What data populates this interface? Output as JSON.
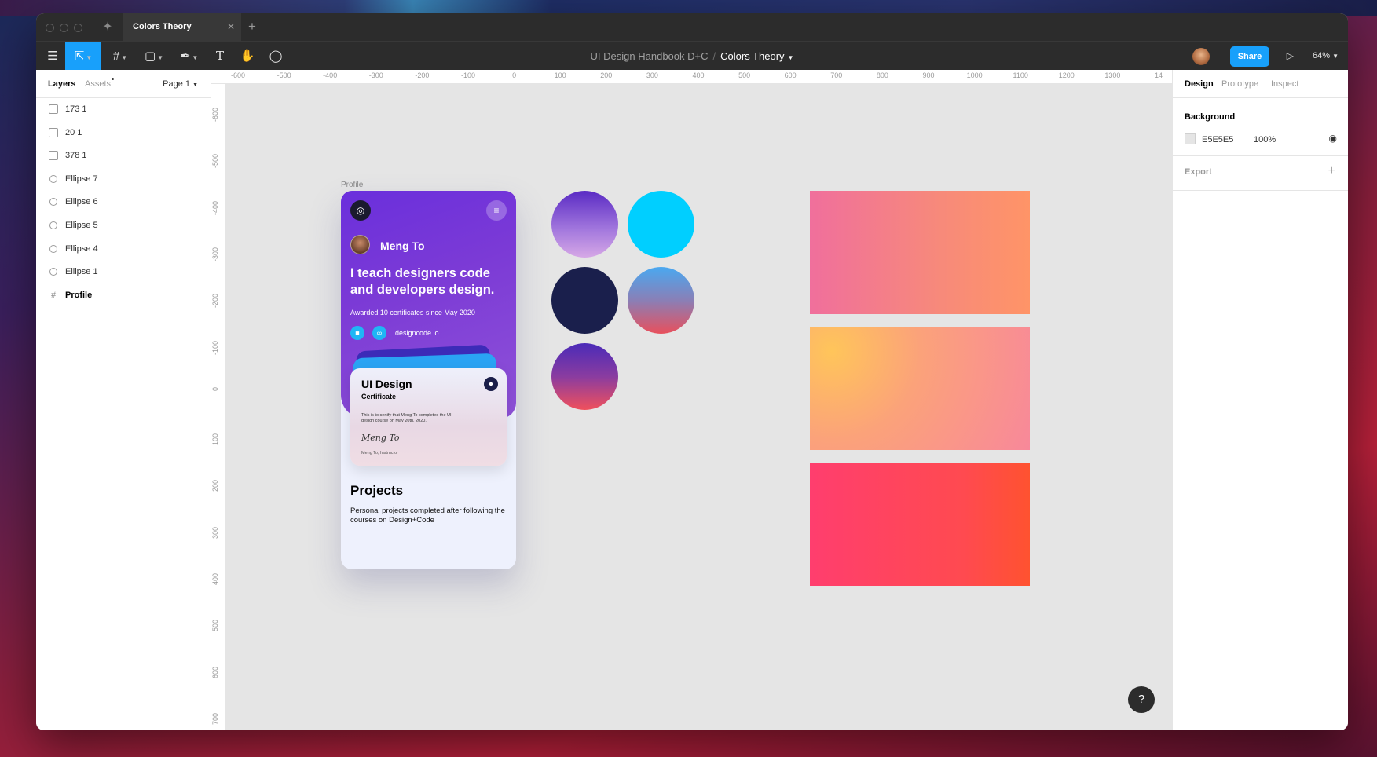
{
  "app": {
    "tab_title": "Colors Theory"
  },
  "toolbar": {
    "project": "UI Design Handbook D+C",
    "separator": "/",
    "file": "Colors Theory",
    "share_label": "Share",
    "zoom": "64%"
  },
  "left_panel": {
    "tab_layers": "Layers",
    "tab_assets": "Assets",
    "page_select": "Page 1",
    "layers": [
      {
        "label": "173 1",
        "type": "image"
      },
      {
        "label": "20 1",
        "type": "image"
      },
      {
        "label": "378 1",
        "type": "image"
      },
      {
        "label": "Ellipse 7",
        "type": "ellipse"
      },
      {
        "label": "Ellipse 6",
        "type": "ellipse"
      },
      {
        "label": "Ellipse 5",
        "type": "ellipse"
      },
      {
        "label": "Ellipse 4",
        "type": "ellipse"
      },
      {
        "label": "Ellipse 1",
        "type": "ellipse"
      },
      {
        "label": "Profile",
        "type": "frame"
      }
    ]
  },
  "ruler": {
    "top": [
      "-600",
      "-500",
      "-400",
      "-300",
      "-200",
      "-100",
      "0",
      "100",
      "200",
      "300",
      "400",
      "500",
      "600",
      "700",
      "800",
      "900",
      "1000",
      "1100",
      "1200",
      "1300",
      "14"
    ],
    "left": [
      "-600",
      "-500",
      "-400",
      "-300",
      "-200",
      "-100",
      "0",
      "100",
      "200",
      "300",
      "400",
      "500",
      "600",
      "700"
    ]
  },
  "canvas": {
    "frame_label": "Profile",
    "profile": {
      "name": "Meng To",
      "headline": "I teach designers code and developers design.",
      "subtitle": "Awarded 10 certificates since May 2020",
      "link": "designcode.io",
      "cert_title": "UI Design",
      "cert_subtitle": "Certificate",
      "cert_body": "This is to certify that Meng To completed the UI design course on May 20th, 2020.",
      "cert_signature": "Meng To",
      "cert_instructor": "Meng To, Instructor",
      "projects_title": "Projects",
      "projects_sub": "Personal projects completed after following the courses on Design+Code"
    },
    "help_label": "?"
  },
  "right_panel": {
    "tab_design": "Design",
    "tab_prototype": "Prototype",
    "tab_inspect": "Inspect",
    "background_title": "Background",
    "background_hex": "E5E5E5",
    "background_opacity": "100%",
    "export_title": "Export"
  },
  "colors": {
    "accent": "#18a0fb",
    "canvas": "#e5e5e5",
    "toolbar": "#2c2c2c"
  }
}
